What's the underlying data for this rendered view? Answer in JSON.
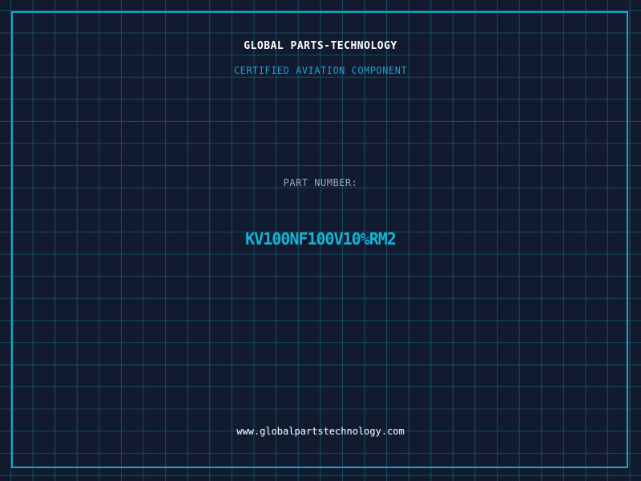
{
  "header": {
    "company": "GLOBAL PARTS-TECHNOLOGY",
    "subtitle": "CERTIFIED AVIATION COMPONENT"
  },
  "part": {
    "label": "PART NUMBER:",
    "number": "KV100NF100V10%RM2"
  },
  "footer": {
    "url": "www.globalpartstechnology.com"
  },
  "colors": {
    "background": "#111a2e",
    "grid": "#1c788c",
    "accent": "#14b4d8",
    "frame": "#17a8c8"
  }
}
